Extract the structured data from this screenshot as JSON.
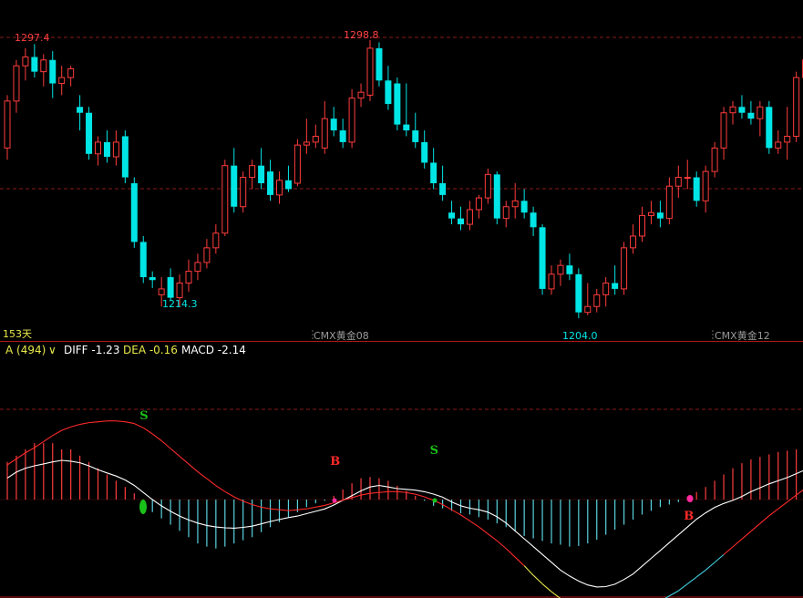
{
  "chart_data": {
    "type": "candlestick",
    "upper": {
      "highs_labels": [
        {
          "text": "1297.4",
          "color": "#ff4040",
          "kind": "high"
        },
        {
          "text": "1298.8",
          "color": "#ff4040",
          "kind": "high"
        },
        {
          "text": "1214.3",
          "color": "#00e5e5",
          "kind": "low"
        },
        {
          "text": "1204.0",
          "color": "#00e5e5",
          "kind": "low"
        }
      ],
      "period_label": "153天",
      "contract_labels": [
        "CMX黄金08",
        "CMX黄金12"
      ],
      "candles": [
        [
          1262,
          1280,
          1258,
          1278
        ],
        [
          1278,
          1292,
          1274,
          1290
        ],
        [
          1290,
          1296,
          1285,
          1293
        ],
        [
          1293,
          1297.4,
          1286,
          1288
        ],
        [
          1288,
          1294,
          1283,
          1292
        ],
        [
          1292,
          1295,
          1279,
          1284
        ],
        [
          1284,
          1290,
          1280,
          1286
        ],
        [
          1286,
          1290,
          1283,
          1289
        ],
        [
          1276,
          1280,
          1268,
          1274
        ],
        [
          1274,
          1276,
          1258,
          1260
        ],
        [
          1260,
          1266,
          1256,
          1264
        ],
        [
          1264,
          1268,
          1257,
          1259
        ],
        [
          1259,
          1268,
          1256,
          1264
        ],
        [
          1266,
          1268,
          1250,
          1252
        ],
        [
          1250,
          1252,
          1228,
          1230
        ],
        [
          1230,
          1232,
          1216,
          1218
        ],
        [
          1218,
          1220,
          1214.3,
          1217
        ],
        [
          1212,
          1218,
          1208,
          1214
        ],
        [
          1218,
          1221,
          1210,
          1211
        ],
        [
          1211,
          1219,
          1208,
          1216
        ],
        [
          1216,
          1224,
          1213,
          1220
        ],
        [
          1220,
          1226,
          1217,
          1223
        ],
        [
          1223,
          1231,
          1221,
          1228
        ],
        [
          1228,
          1236,
          1226,
          1233
        ],
        [
          1233,
          1258,
          1232,
          1256
        ],
        [
          1256,
          1262,
          1240,
          1242
        ],
        [
          1242,
          1254,
          1240,
          1252
        ],
        [
          1252,
          1258,
          1248,
          1256
        ],
        [
          1256,
          1262,
          1248,
          1250
        ],
        [
          1254,
          1258,
          1244,
          1246
        ],
        [
          1246,
          1254,
          1243,
          1251
        ],
        [
          1251,
          1256,
          1247,
          1248
        ],
        [
          1250,
          1265,
          1249,
          1263
        ],
        [
          1263,
          1272,
          1260,
          1264
        ],
        [
          1264,
          1270,
          1262,
          1266
        ],
        [
          1262,
          1278,
          1260,
          1272
        ],
        [
          1272,
          1276,
          1266,
          1268
        ],
        [
          1268,
          1272,
          1262,
          1264
        ],
        [
          1264,
          1282,
          1262,
          1279
        ],
        [
          1279,
          1284,
          1276,
          1281
        ],
        [
          1280,
          1298.8,
          1278,
          1296
        ],
        [
          1296,
          1298,
          1283,
          1285
        ],
        [
          1285,
          1290,
          1275,
          1277
        ],
        [
          1284,
          1286,
          1268,
          1270
        ],
        [
          1270,
          1284,
          1266,
          1268
        ],
        [
          1268,
          1274,
          1262,
          1264
        ],
        [
          1264,
          1268,
          1255,
          1257
        ],
        [
          1257,
          1262,
          1248,
          1250
        ],
        [
          1250,
          1256,
          1244,
          1246
        ],
        [
          1240,
          1244,
          1236,
          1238
        ],
        [
          1238,
          1242,
          1234,
          1236
        ],
        [
          1236,
          1244,
          1234,
          1241
        ],
        [
          1241,
          1246,
          1238,
          1245
        ],
        [
          1245,
          1255,
          1243,
          1253
        ],
        [
          1253,
          1254,
          1236,
          1238
        ],
        [
          1238,
          1244,
          1235,
          1242
        ],
        [
          1242,
          1250,
          1238,
          1244
        ],
        [
          1244,
          1248,
          1238,
          1240
        ],
        [
          1240,
          1242,
          1232,
          1235
        ],
        [
          1235,
          1236,
          1212,
          1214
        ],
        [
          1214,
          1222,
          1212,
          1219
        ],
        [
          1219,
          1224,
          1215,
          1222
        ],
        [
          1222,
          1226,
          1217,
          1219
        ],
        [
          1219,
          1221,
          1204,
          1206
        ],
        [
          1206,
          1216,
          1205,
          1208
        ],
        [
          1208,
          1214,
          1206,
          1212
        ],
        [
          1212,
          1218,
          1208,
          1216
        ],
        [
          1216,
          1222,
          1212,
          1214
        ],
        [
          1214,
          1230,
          1212,
          1228
        ],
        [
          1228,
          1236,
          1226,
          1232
        ],
        [
          1232,
          1242,
          1230,
          1239
        ],
        [
          1239,
          1244,
          1236,
          1240
        ],
        [
          1240,
          1244,
          1235,
          1238
        ],
        [
          1238,
          1252,
          1236,
          1249
        ],
        [
          1249,
          1256,
          1245,
          1252
        ],
        [
          1252,
          1258,
          1248,
          1252
        ],
        [
          1252,
          1254,
          1242,
          1244
        ],
        [
          1244,
          1256,
          1240,
          1254
        ],
        [
          1254,
          1264,
          1252,
          1262
        ],
        [
          1262,
          1276,
          1258,
          1274
        ],
        [
          1274,
          1278,
          1270,
          1276
        ],
        [
          1276,
          1280,
          1272,
          1274
        ],
        [
          1274,
          1278,
          1270,
          1272
        ],
        [
          1272,
          1278,
          1266,
          1276
        ],
        [
          1276,
          1278,
          1260,
          1262
        ],
        [
          1262,
          1268,
          1260,
          1264
        ],
        [
          1264,
          1276,
          1258,
          1266
        ],
        [
          1266,
          1288,
          1264,
          1286
        ],
        [
          1286,
          1296,
          1282,
          1292
        ]
      ],
      "reference_levels": [
        1297.4,
        1250
      ]
    },
    "lower": {
      "indicator_name": "A (494)",
      "diff_label": "DIFF -1.23",
      "dea_label": "DEA -0.16",
      "macd_label": "MACD -2.14",
      "signals": [
        {
          "text": "S",
          "color": "#19c019",
          "bar": 15
        },
        {
          "text": "B",
          "color": "#ff2a2a",
          "bar": 36
        },
        {
          "text": "S",
          "color": "#19c019",
          "bar": 47
        },
        {
          "text": "B",
          "color": "#ff2a2a",
          "bar": 75
        }
      ],
      "histogram": [
        6,
        7,
        8,
        9,
        9,
        9,
        8,
        8,
        7,
        6,
        5,
        4,
        3,
        2,
        1,
        -0.5,
        -2,
        -3,
        -4,
        -5,
        -6,
        -7,
        -7.5,
        -7.8,
        -7.5,
        -7,
        -6.5,
        -6,
        -5.2,
        -4.4,
        -3.6,
        -2.8,
        -2,
        -1.2,
        -0.6,
        -0.2,
        0.6,
        1.6,
        2.6,
        3.4,
        3.6,
        3.4,
        3,
        2.2,
        1.4,
        0.6,
        -0.2,
        -1,
        -1.4,
        -1.8,
        -2.2,
        -2.4,
        -2.8,
        -3.2,
        -3.8,
        -4.4,
        -5,
        -5.8,
        -6.2,
        -6.6,
        -7,
        -7.2,
        -7.5,
        -7.4,
        -7,
        -6.4,
        -5.6,
        -4.8,
        -4,
        -3.2,
        -2.4,
        -1.8,
        -1.2,
        -0.8,
        -0.4,
        0.4,
        1.2,
        2,
        3,
        4,
        5,
        5.8,
        6.4,
        6.8,
        7.2,
        7.6,
        7.8,
        8,
        8.2,
        8.4
      ],
      "diff_line": [
        5.5,
        7,
        8,
        8.6,
        9.1,
        9.6,
        10,
        9.8,
        9.4,
        8.6,
        7.6,
        6.8,
        6,
        5,
        3.6,
        1.8,
        0,
        -1.6,
        -3,
        -4.2,
        -5.2,
        -6,
        -6.6,
        -7,
        -7.2,
        -7.3,
        -7.1,
        -6.8,
        -6.2,
        -5.6,
        -5.1,
        -4.6,
        -4.2,
        -3.6,
        -3,
        -2.4,
        -1.4,
        -0.2,
        1,
        2.2,
        3.2,
        3.6,
        3.2,
        2.8,
        2.6,
        2.4,
        2,
        1.4,
        0.6,
        -0.6,
        -1.6,
        -2.2,
        -2.6,
        -3.2,
        -4.4,
        -6,
        -8,
        -10,
        -12,
        -14,
        -16,
        -18,
        -19.5,
        -20.8,
        -21.8,
        -22.3,
        -22.2,
        -21.6,
        -20.4,
        -19,
        -17,
        -15,
        -13,
        -11,
        -9,
        -7,
        -5,
        -3.4,
        -2,
        -1,
        -0.2,
        0.8,
        2,
        3,
        4,
        4.8,
        5.6,
        6.6,
        7.6,
        8.6,
        9.4
      ],
      "dea_line": [
        2.2,
        2.9,
        3.6,
        4.2,
        4.9,
        5.6,
        6.2,
        6.6,
        6.9,
        7.1,
        7.2,
        7.3,
        7.3,
        7.2,
        7,
        6.5,
        5.8,
        5,
        4.1,
        3.2,
        2.3,
        1.4,
        0.6,
        -0.2,
        -0.9,
        -1.5,
        -2,
        -2.4,
        -2.7,
        -2.9,
        -3,
        -3.1,
        -3,
        -2.9,
        -2.7,
        -2.5,
        -2.2,
        -1.9,
        -1.6,
        -1.3,
        -1.1,
        -1,
        -0.9,
        -0.9,
        -1,
        -1.2,
        -1.5,
        -1.9,
        -2.4,
        -3,
        -3.6,
        -4.3,
        -5,
        -5.8,
        -6.6,
        -7.5,
        -8.5,
        -9.5,
        -10.6,
        -11.6,
        -12.5,
        -13.3,
        -14,
        -14.6,
        -15.1,
        -15.4,
        -15.6,
        -15.6,
        -15.5,
        -15.2,
        -14.8,
        -14.2,
        -13.6,
        -13,
        -12.4,
        -11.6,
        -10.8,
        -10,
        -9.1,
        -8.2,
        -7.3,
        -6.4,
        -5.5,
        -4.6,
        -3.7,
        -2.9,
        -2.1,
        -1.3,
        -0.5,
        0.2,
        0.9
      ]
    }
  },
  "colors": {
    "up": "#ff3c3c",
    "down": "#00e5e5",
    "grid": "#8a1a1a",
    "separator": "#b01818",
    "diff": "#ffffff",
    "dea_up": "#ff2a2a",
    "dea_down": "#e8e84a",
    "dea_low": "#40d0e0",
    "hist_up": "#ff3c3c",
    "hist_down": "#5ad3e0",
    "label_yellow": "#e8e84a",
    "label_gray": "#9a9a9a"
  }
}
